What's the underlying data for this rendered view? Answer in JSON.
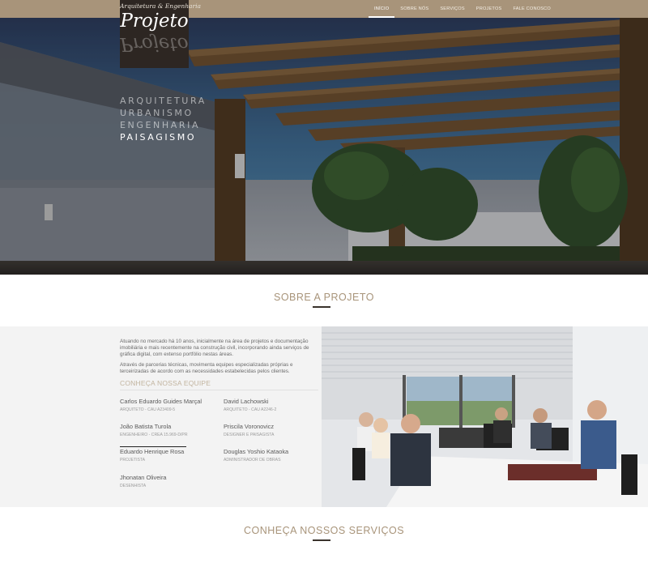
{
  "brand": {
    "logo_top": "Arquitetura & Engenharia",
    "logo_main": "Projeto",
    "tagline": [
      "ARQUITETURA",
      "URBANISMO",
      "ENGENHARIA",
      "PAISAGISMO"
    ]
  },
  "nav": {
    "items": [
      {
        "label": "INÍCIO",
        "active": true
      },
      {
        "label": "SOBRE NÓS",
        "active": false
      },
      {
        "label": "SERVIÇOS",
        "active": false
      },
      {
        "label": "PROJETOS",
        "active": false
      },
      {
        "label": "FALE CONOSCO",
        "active": false
      }
    ]
  },
  "about": {
    "heading": "SOBRE A PROJETO",
    "paragraph1": "Atuando no mercado há 10 anos, inicialmente na área de projetos e documentação imobiliária e mais recentemente na construção civil, incorporando ainda serviços de gráfica digital, com extenso portfólio nestas áreas.",
    "paragraph2": "Através de parcerias técnicas, movimenta equipes especializadas próprias e terceirizadas de acordo com as necessidades estabelecidas pelos clientes.",
    "team_title": "CONHEÇA NOSSA EQUIPE",
    "team": [
      {
        "name": "Carlos Eduardo Guides Marçal",
        "role": "ARQUITETO - CAU A23409-5"
      },
      {
        "name": "David Lachowski",
        "role": "ARQUITETO - CAU A2246-2"
      },
      {
        "name": "João Batista Turola",
        "role": "ENGENHEIRO - CREA 15.969-D/PR"
      },
      {
        "name": "Priscila Voronovicz",
        "role": "DESIGNER E PAISAGISTA"
      },
      {
        "name": "Eduardo Henrique Rosa",
        "role": "PROJETISTA"
      },
      {
        "name": "Douglas Yoshio Kataoka",
        "role": "ADMINISTRADOR DE OBRAS"
      },
      {
        "name": "Jhonatan Oliveira",
        "role": "DESENHISTA"
      }
    ]
  },
  "services": {
    "heading": "CONHEÇA NOSSOS SERVIÇOS"
  },
  "colors": {
    "nav_bg": "#a8947a",
    "accent": "#a8947a",
    "logo_bg": "#2d2622",
    "section_bg": "#f3f3f3"
  },
  "icons": {
    "hero": "pergola-render-image",
    "photo": "office-team-photo"
  }
}
